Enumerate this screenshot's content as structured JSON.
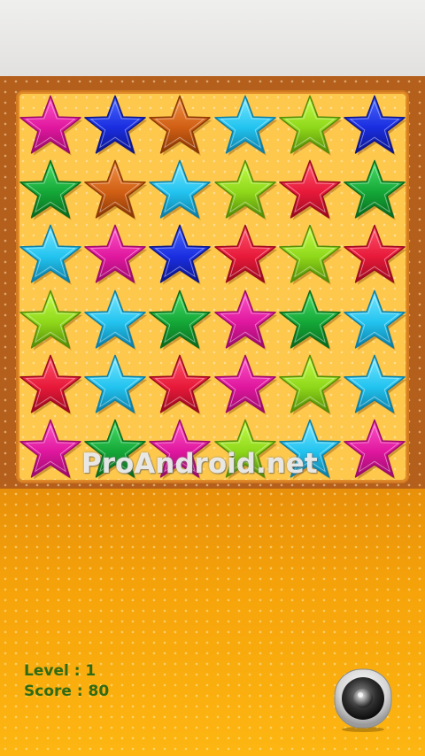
{
  "hud": {
    "level_text": "Level : 1",
    "score_text": "Score : 80"
  },
  "watermark": "ProAndroid.net",
  "board": {
    "rows": 6,
    "cols": 6,
    "grid": [
      [
        "magenta",
        "blue",
        "orange",
        "cyan",
        "lime",
        "blue"
      ],
      [
        "green",
        "orange",
        "cyan",
        "lime",
        "red",
        "green"
      ],
      [
        "cyan",
        "magenta",
        "blue",
        "red",
        "lime",
        "red"
      ],
      [
        "lime",
        "cyan",
        "green",
        "magenta",
        "green",
        "cyan"
      ],
      [
        "red",
        "cyan",
        "red",
        "magenta",
        "lime",
        "cyan"
      ],
      [
        "magenta",
        "green",
        "magenta",
        "lime",
        "cyan",
        "magenta"
      ]
    ]
  },
  "colors": {
    "magenta": [
      "#ff5bc8",
      "#e0179f",
      "#9c0a6c"
    ],
    "blue": [
      "#4d6bff",
      "#1a2ee0",
      "#0c168c"
    ],
    "orange": [
      "#f2944a",
      "#d05f14",
      "#8a3806"
    ],
    "cyan": [
      "#7fe8ff",
      "#22c4f0",
      "#0c7ea6"
    ],
    "lime": [
      "#c6ff4e",
      "#8fd81a",
      "#548c08"
    ],
    "green": [
      "#4ee06a",
      "#14a838",
      "#0a6a1e"
    ],
    "red": [
      "#ff5a70",
      "#e8193a",
      "#9a0a20"
    ]
  },
  "sound_button": {
    "icon": "speaker-icon"
  }
}
